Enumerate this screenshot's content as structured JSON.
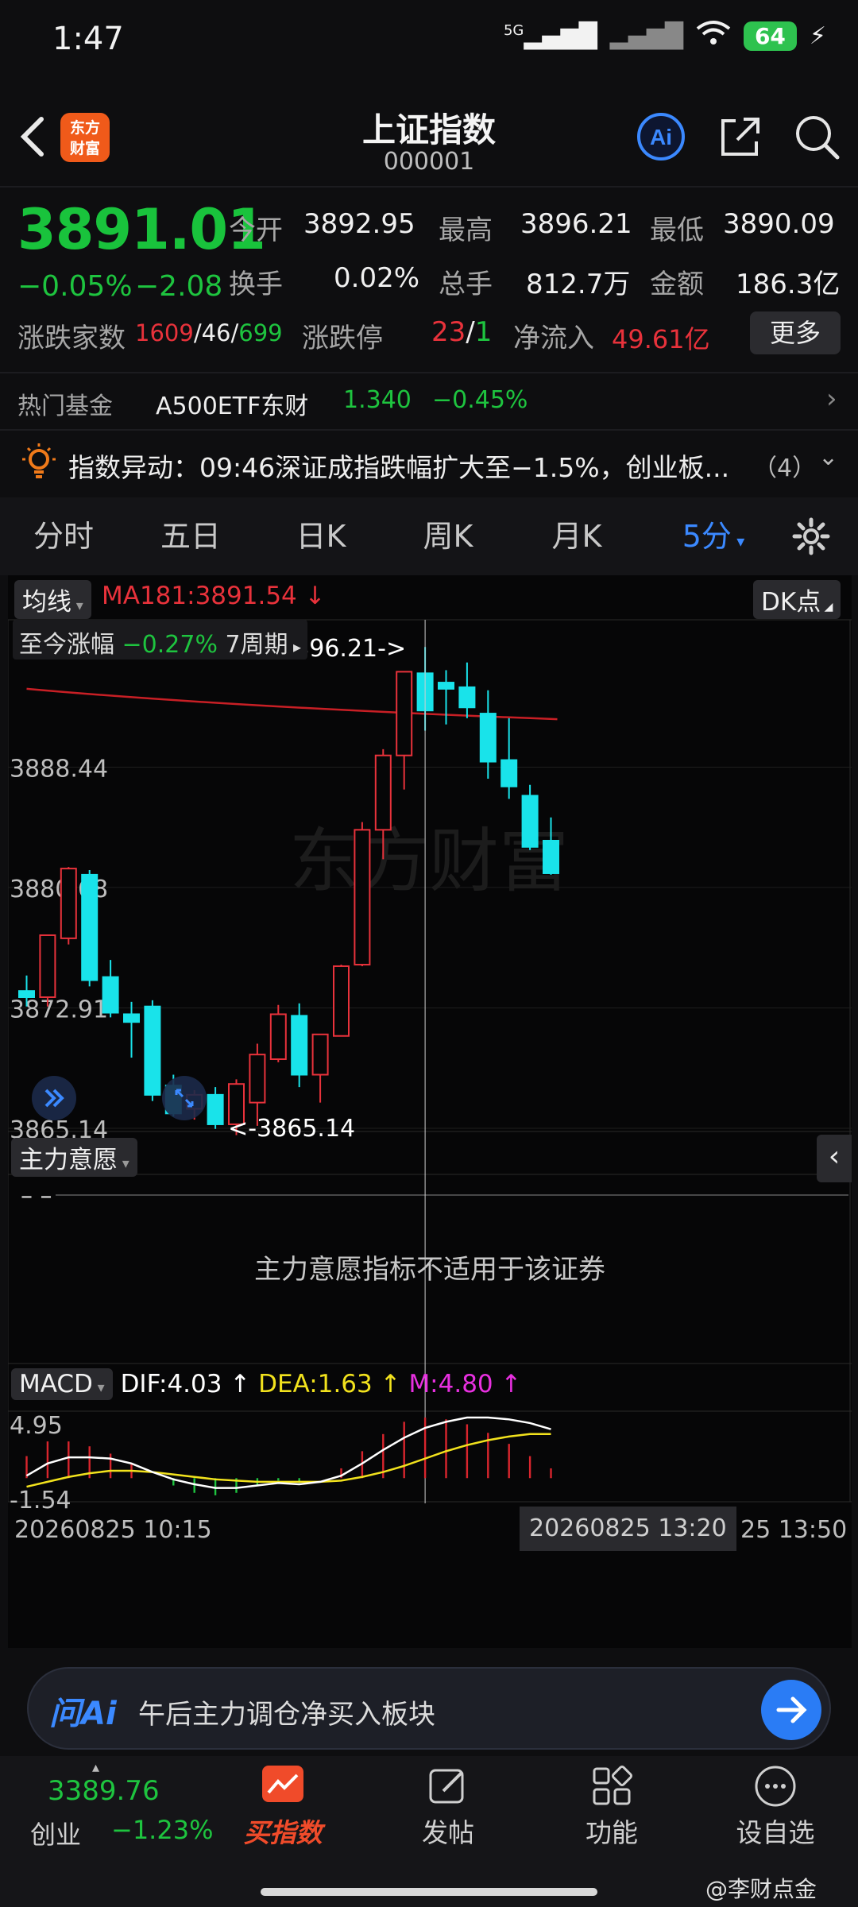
{
  "status_bar": {
    "time": "1:47",
    "network": "5G",
    "battery": "64"
  },
  "header": {
    "title": "上证指数",
    "code": "000001",
    "logo_text": "东方\n财富"
  },
  "quote": {
    "price": "3891.01",
    "change_pct": "−0.05%",
    "change": "−2.08",
    "open_label": "今开",
    "open": "3892.95",
    "high_label": "最高",
    "high": "3896.21",
    "low_label": "最低",
    "low": "3890.09",
    "turnover_label": "换手",
    "turnover": "0.02%",
    "volume_label": "总手",
    "volume": "812.7万",
    "amount_label": "金额",
    "amount": "186.3亿",
    "breadth_label": "涨跌家数",
    "breadth_up": "1609",
    "breadth_flat": "46",
    "breadth_down": "699",
    "limit_label": "涨跌停",
    "limit_up": "23",
    "limit_down": "1",
    "inflow_label": "净流入",
    "inflow": "49.61亿",
    "more_button": "更多"
  },
  "hot_fund": {
    "label": "热门基金",
    "name": "A500ETF东财",
    "price": "1.340",
    "change": "−0.45%"
  },
  "alert": {
    "text": "指数异动：09:46深证成指跌幅扩大至−1.5%，创业板...",
    "count": "（4）"
  },
  "tabs": [
    {
      "label": "分时",
      "active": false
    },
    {
      "label": "五日",
      "active": false
    },
    {
      "label": "日K",
      "active": false
    },
    {
      "label": "周K",
      "active": false
    },
    {
      "label": "月K",
      "active": false
    },
    {
      "label": "5分",
      "active": true
    }
  ],
  "chart_data": [
    {
      "type": "candlestick",
      "indicator_label": "均线",
      "ma_label": "MA181:3891.54",
      "dk_label": "DK点",
      "range_label": "至今涨幅",
      "range_value": "−0.27%",
      "range_period": "7周期",
      "y_ticks": [
        "3888.44",
        "3880.68",
        "3872.91",
        "3865.14"
      ],
      "ylim": [
        3865.14,
        3896.21
      ],
      "high_marker": "3896.21->",
      "low_marker": "<-3865.14",
      "ma181_level": 3891.54,
      "candles": [
        {
          "o": 3874.0,
          "h": 3875.0,
          "c": 3873.6,
          "l": 3873.0
        },
        {
          "o": 3873.6,
          "h": 3877.0,
          "c": 3877.6,
          "l": 3873.0
        },
        {
          "o": 3877.4,
          "h": 3882.0,
          "c": 3881.9,
          "l": 3877.0
        },
        {
          "o": 3881.5,
          "h": 3881.8,
          "c": 3874.7,
          "l": 3874.3
        },
        {
          "o": 3874.9,
          "h": 3876.0,
          "c": 3872.6,
          "l": 3872.3
        },
        {
          "o": 3872.5,
          "h": 3873.3,
          "c": 3872.0,
          "l": 3869.7
        },
        {
          "o": 3873.0,
          "h": 3873.4,
          "c": 3867.3,
          "l": 3866.9
        },
        {
          "o": 3867.9,
          "h": 3868.6,
          "c": 3866.1,
          "l": 3865.9
        },
        {
          "o": 3866.4,
          "h": 3867.6,
          "c": 3867.3,
          "l": 3865.7
        },
        {
          "o": 3867.3,
          "h": 3867.8,
          "c": 3865.4,
          "l": 3865.1
        },
        {
          "o": 3865.4,
          "h": 3868.3,
          "c": 3868.0,
          "l": 3864.7
        },
        {
          "o": 3866.8,
          "h": 3870.6,
          "c": 3869.9,
          "l": 3865.3
        },
        {
          "o": 3869.6,
          "h": 3873.1,
          "c": 3872.5,
          "l": 3869.4
        },
        {
          "o": 3872.4,
          "h": 3873.2,
          "c": 3868.6,
          "l": 3867.8
        },
        {
          "o": 3868.6,
          "h": 3871.2,
          "c": 3871.2,
          "l": 3866.8
        },
        {
          "o": 3871.1,
          "h": 3875.7,
          "c": 3875.6,
          "l": 3871.1
        },
        {
          "o": 3875.7,
          "h": 3884.9,
          "c": 3884.4,
          "l": 3875.6
        },
        {
          "o": 3884.4,
          "h": 3889.6,
          "c": 3889.2,
          "l": 3882.5
        },
        {
          "o": 3889.2,
          "h": 3894.6,
          "c": 3894.6,
          "l": 3887.0
        },
        {
          "o": 3894.5,
          "h": 3896.2,
          "c": 3892.1,
          "l": 3890.8
        },
        {
          "o": 3893.9,
          "h": 3894.7,
          "c": 3893.5,
          "l": 3891.2
        },
        {
          "o": 3893.6,
          "h": 3895.2,
          "c": 3892.3,
          "l": 3891.6
        },
        {
          "o": 3891.9,
          "h": 3893.4,
          "c": 3888.8,
          "l": 3887.7
        },
        {
          "o": 3888.9,
          "h": 3891.6,
          "c": 3887.2,
          "l": 3886.4
        },
        {
          "o": 3886.6,
          "h": 3887.3,
          "c": 3883.3,
          "l": 3883.1
        },
        {
          "o": 3883.7,
          "h": 3885.2,
          "c": 3881.6,
          "l": 3881.5
        }
      ]
    },
    {
      "type": "indicator",
      "label": "主力意愿",
      "placeholder": "– –",
      "message": "主力意愿指标不适用于该证券"
    },
    {
      "type": "macd",
      "label": "MACD",
      "dif_label": "DIF:4.03",
      "dea_label": "DEA:1.63",
      "m_label": "M:4.80",
      "y_ticks": [
        "4.95",
        "-1.54"
      ],
      "ylim": [
        -1.54,
        4.95
      ],
      "x_ticks": [
        "20260825 10:15",
        "20260825 13:20",
        "25 13:50"
      ],
      "dif": [
        0.2,
        1.2,
        1.7,
        1.7,
        1.6,
        1.2,
        0.5,
        -0.1,
        -0.5,
        -0.8,
        -0.8,
        -0.6,
        -0.4,
        -0.5,
        -0.3,
        0.2,
        1.2,
        2.3,
        3.3,
        4.1,
        4.6,
        4.95,
        4.95,
        4.8,
        4.5,
        4.0
      ],
      "dea": [
        -0.7,
        -0.3,
        0.1,
        0.4,
        0.6,
        0.6,
        0.5,
        0.3,
        0.1,
        -0.1,
        -0.2,
        -0.3,
        -0.3,
        -0.3,
        -0.3,
        -0.2,
        0.1,
        0.5,
        1.0,
        1.6,
        2.2,
        2.7,
        3.1,
        3.4,
        3.6,
        3.6
      ],
      "hist": [
        1.8,
        3.0,
        3.0,
        2.6,
        2.0,
        1.2,
        0.0,
        -0.6,
        -1.2,
        -1.4,
        -1.2,
        -0.6,
        -0.2,
        -0.4,
        0.0,
        0.8,
        2.2,
        3.6,
        4.6,
        4.95,
        4.8,
        4.4,
        3.7,
        2.8,
        1.8,
        0.8
      ]
    }
  ],
  "ai_bar": {
    "brand": "问Ai",
    "prompt": "午后主力调仓净买入板块"
  },
  "bottom_nav": {
    "ticker_price": "3389.76",
    "ticker_name": "创业",
    "ticker_change": "−1.23%",
    "items": [
      {
        "label": "买指数",
        "active": true
      },
      {
        "label": "发帖",
        "active": false
      },
      {
        "label": "功能",
        "active": false
      },
      {
        "label": "设自选",
        "active": false
      }
    ]
  },
  "watermark": "@李财点金",
  "chart_watermark": "东方财富",
  "colors": {
    "up": "#e8323b",
    "down": "#19e3ea",
    "green": "#1ec43f",
    "accent": "#3b89ff",
    "dif": "#ffffff",
    "dea": "#f2e21d",
    "ma": "#c81f25"
  }
}
